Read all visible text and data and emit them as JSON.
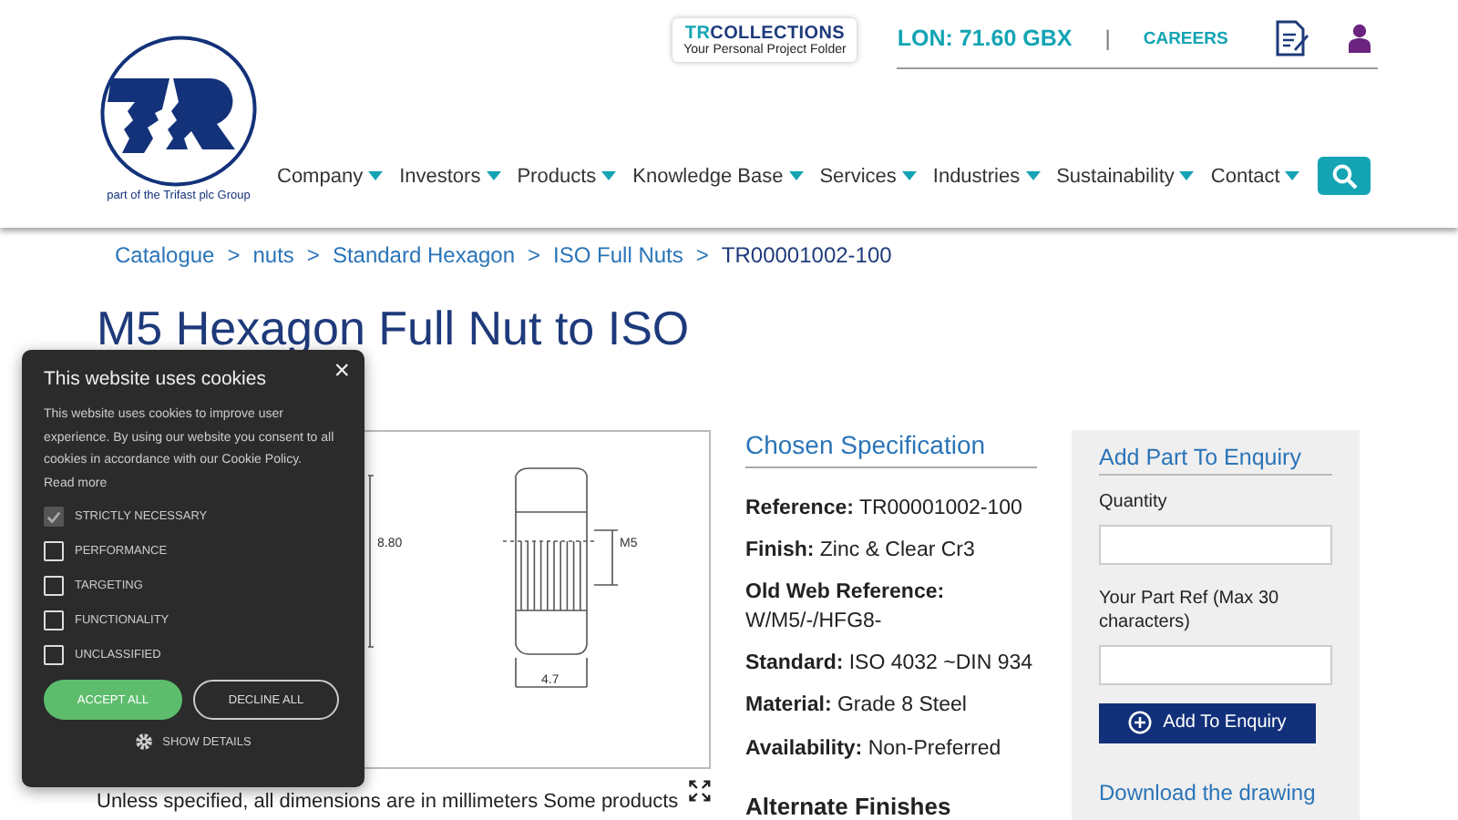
{
  "header": {
    "logo_caption": "part of the Trifast plc Group",
    "collections": {
      "brand_prefix": "TR",
      "brand": "COLLECTIONS",
      "tagline": "Your Personal Project Folder"
    },
    "share_price": "LON: 71.60 GBX",
    "separator": "|",
    "careers": "CAREERS",
    "nav": [
      "Company",
      "Investors",
      "Products",
      "Knowledge Base",
      "Services",
      "Industries",
      "Sustainability",
      "Contact"
    ]
  },
  "breadcrumb": [
    {
      "label": "Catalogue",
      "current": false
    },
    {
      "label": "nuts",
      "current": false
    },
    {
      "label": "Standard Hexagon",
      "current": false
    },
    {
      "label": "ISO Full Nuts",
      "current": false
    },
    {
      "label": "TR00001002-100",
      "current": true
    }
  ],
  "breadcrumb_separator": ">",
  "title": "M5 Hexagon Full Nut to ISO",
  "drawing": {
    "height_label": "8.80",
    "thread_label": "M5",
    "width_label": "4.7"
  },
  "note": "Unless specified, all dimensions are in millimeters Some products",
  "spec": {
    "heading": "Chosen Specification",
    "fields": [
      {
        "label": "Reference:",
        "value": "TR00001002-100"
      },
      {
        "label": "Finish:",
        "value": "Zinc & Clear Cr3"
      },
      {
        "label": "Old Web Reference:",
        "value": "W/M5/-/HFG8-"
      },
      {
        "label": "Standard:",
        "value": "ISO 4032 ~DIN 934"
      },
      {
        "label": "Material:",
        "value": "Grade 8 Steel"
      },
      {
        "label": "Availability:",
        "value": "Non-Preferred"
      }
    ],
    "alternate_heading": "Alternate Finishes"
  },
  "enquiry": {
    "heading": "Add Part To Enquiry",
    "fields": [
      {
        "label": "Quantity"
      },
      {
        "label": "Your Part Ref (Max 30 characters)"
      }
    ],
    "button": "Add To Enquiry",
    "download": "Download the drawing"
  },
  "cookie": {
    "close": "×",
    "title": "This website uses cookies",
    "body": "This website uses cookies to improve user experience. By using our website you consent to all cookies in accordance with our Cookie Policy.",
    "read_more": "Read more",
    "options": [
      {
        "label": "STRICTLY NECESSARY",
        "checked": true,
        "disabled": true
      },
      {
        "label": "PERFORMANCE",
        "checked": false,
        "disabled": false
      },
      {
        "label": "TARGETING",
        "checked": false,
        "disabled": false
      },
      {
        "label": "FUNCTIONALITY",
        "checked": false,
        "disabled": false
      },
      {
        "label": "UNCLASSIFIED",
        "checked": false,
        "disabled": false
      }
    ],
    "accept": "ACCEPT ALL",
    "decline": "DECLINE ALL",
    "details": "SHOW DETAILS"
  }
}
